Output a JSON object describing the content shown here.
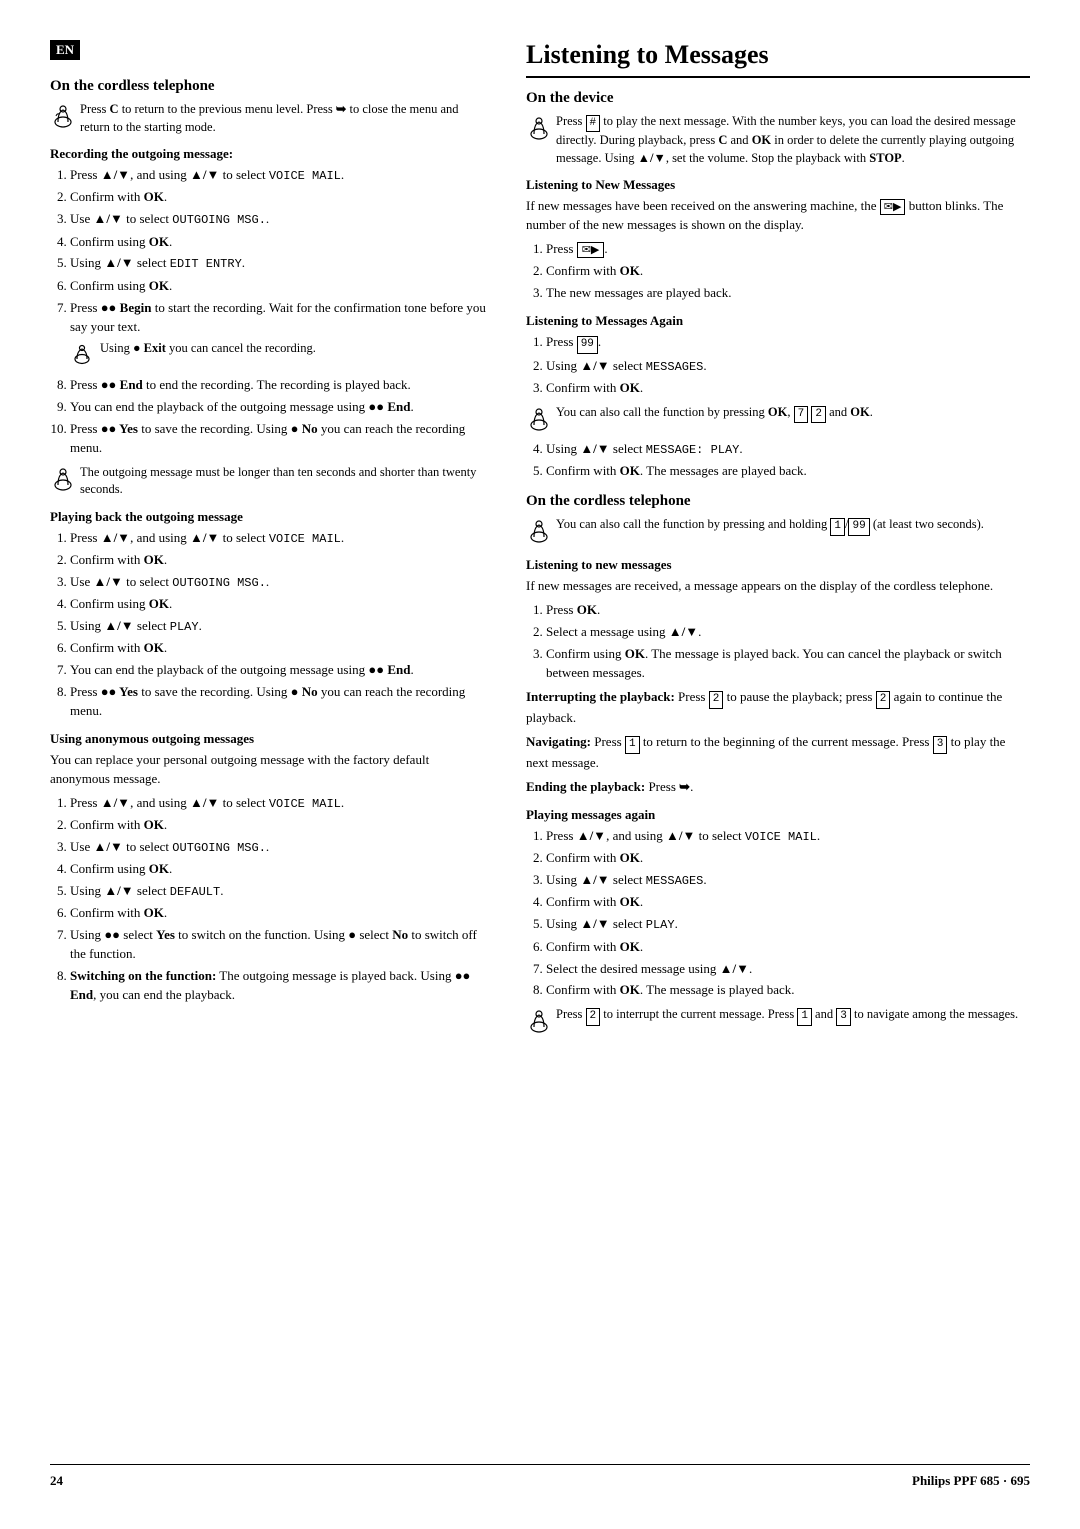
{
  "page": {
    "number": "24",
    "brand": "Philips PPF 685 · 695"
  },
  "en_badge": "EN",
  "left": {
    "section1": {
      "title": "On the cordless telephone",
      "note1": "Press C to return to the previous menu level. Press ➥ to close the menu and return to the starting mode.",
      "recording_title": "Recording the outgoing message:",
      "steps": [
        "Press ▲/▼, and using ▲/▼ to select VOICE MAIL.",
        "Confirm with OK.",
        "Use ▲/▼ to select OUTGOING MSG..",
        "Confirm using OK.",
        "Using ▲/▼ select EDIT ENTRY.",
        "Confirm using OK.",
        "Press ●● Begin to start the recording. Wait for the confirmation tone before you say your text.",
        "Press ●● End to end the recording. The recording is played back.",
        "You can end the playback of the outgoing message using ●● End.",
        "Press ●● Yes to save the recording. Using ● No you can reach the recording menu."
      ],
      "note2": "Using ● Exit you can cancel the recording.",
      "note3": "The outgoing message must be longer than ten seconds and shorter than twenty seconds."
    },
    "section2": {
      "title": "Playing back the outgoing message",
      "steps": [
        "Press ▲/▼, and using ▲/▼ to select VOICE MAIL.",
        "Confirm with OK.",
        "Use ▲/▼ to select OUTGOING MSG..",
        "Confirm using OK.",
        "Using ▲/▼ select PLAY.",
        "Confirm with OK.",
        "You can end the playback of the outgoing message using ●● End.",
        "Press ●● Yes to save the recording. Using ● No you can reach the recording menu."
      ]
    },
    "section3": {
      "title": "Using anonymous outgoing messages",
      "intro": "You can replace your personal outgoing message with the factory default anonymous message.",
      "steps": [
        "Press ▲/▼, and using ▲/▼ to select VOICE MAIL.",
        "Confirm with OK.",
        "Use ▲/▼ to select OUTGOING MSG..",
        "Confirm using OK.",
        "Using ▲/▼ select DEFAULT.",
        "Confirm with OK.",
        "Using ●● select Yes to switch on the function. Using ● select No to switch off the function.",
        "Switching on the function: The outgoing message is played back. Using ●● End, you can end the playback."
      ]
    }
  },
  "right": {
    "main_title": "Listening to Messages",
    "section1": {
      "title": "On the device",
      "intro": "Press [#] to play the next message. With the number keys, you can load the desired message directly. During playback, press C and OK in order to delete the currently playing outgoing message. Using ▲/▼, set the volume. Stop the playback with STOP.",
      "sub1": {
        "title": "Listening to New Messages",
        "intro": "If new messages have been received on the answering machine, the [✉▶] button blinks. The number of the new messages is shown on the display.",
        "steps": [
          "Press [✉▶].",
          "Confirm with OK.",
          "The new messages are played back."
        ]
      },
      "sub2": {
        "title": "Listening to Messages Again",
        "steps": [
          "Press [99].",
          "Using ▲/▼ select MESSAGES.",
          "Confirm with OK."
        ],
        "note1": "You can also call the function by pressing OK, [7] [2] and OK.",
        "steps2": [
          "Using ▲/▼ select MESSAGE: PLAY.",
          "Confirm with OK. The messages are played back."
        ]
      }
    },
    "section2": {
      "title": "On the cordless telephone",
      "note1": "You can also call the function by pressing and holding [1]/[99] (at least two seconds).",
      "sub1": {
        "title": "Listening to new messages",
        "intro": "If new messages are received, a message appears on the display of the cordless telephone.",
        "steps": [
          "Press OK.",
          "Select a message using ▲/▼.",
          "Confirm using OK. The message is played back. You can cancel the playback or switch between messages."
        ]
      },
      "interrupting": "Interrupting the playback: Press [2] to pause the playback; press [2] again to continue the playback.",
      "navigating": "Navigating: Press [1] to return to the beginning of the current message. Press [3] to play the next message.",
      "ending": "Ending the playback: Press ➥.",
      "sub2": {
        "title": "Playing messages again",
        "steps": [
          "Press ▲/▼, and using ▲/▼ to select VOICE MAIL.",
          "Confirm with OK.",
          "Using ▲/▼ select MESSAGES.",
          "Confirm with OK.",
          "Using ▲/▼ select PLAY.",
          "Confirm with OK.",
          "Select the desired message using ▲/▼.",
          "Confirm with OK. The message is played back."
        ],
        "note1": "Press [2] to interrupt the current message. Press [1] and [3] to navigate among the messages."
      }
    }
  }
}
